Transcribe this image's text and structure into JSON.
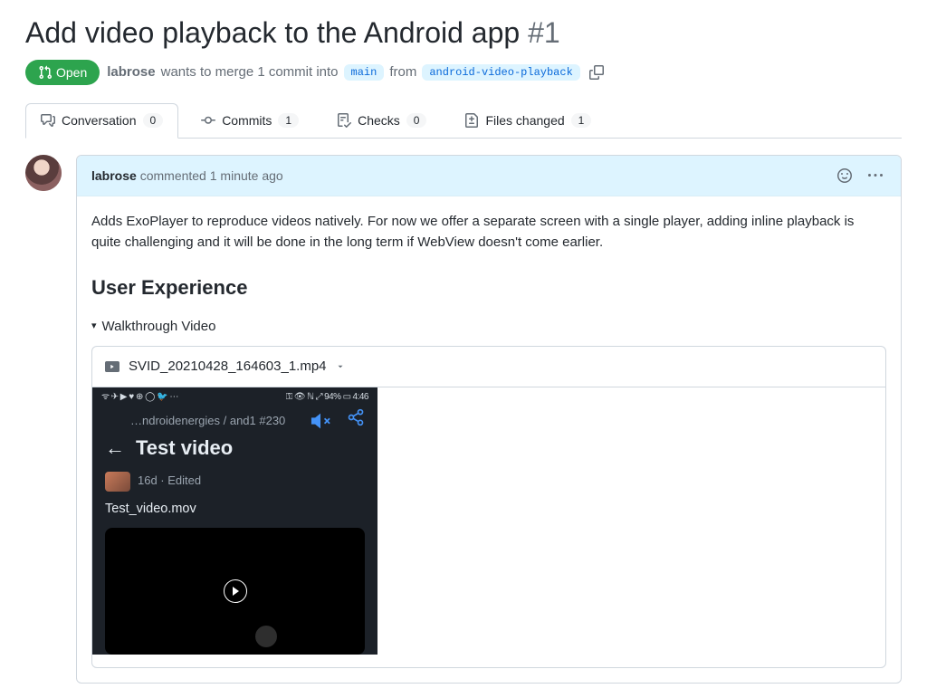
{
  "pr": {
    "title": "Add video playback to the Android app",
    "number": "#1",
    "state": "Open",
    "author": "labrose",
    "merge_text_1": "wants to merge 1 commit into",
    "base_branch": "main",
    "merge_text_2": "from",
    "head_branch": "android-video-playback"
  },
  "tabs": {
    "conversation": {
      "label": "Conversation",
      "count": "0"
    },
    "commits": {
      "label": "Commits",
      "count": "1"
    },
    "checks": {
      "label": "Checks",
      "count": "0"
    },
    "files": {
      "label": "Files changed",
      "count": "1"
    }
  },
  "comment": {
    "author": "labrose",
    "action": "commented",
    "time": "1 minute ago",
    "body": "Adds ExoPlayer to reproduce videos natively. For now we offer a separate screen with a single player, adding inline playback is quite challenging and it will be done in the long term if WebView doesn't come earlier.",
    "section_heading": "User Experience",
    "walkthrough_label": "Walkthrough Video",
    "video_filename": "SVID_20210428_164603_1.mp4"
  },
  "mobile": {
    "status_left": "✈ ▶ ♥ ⊕ ◯ 🐦 ⋯",
    "status_right_pct": "94%",
    "status_time": "4:46",
    "breadcrumb": "…ndroidenergies / and1 #230",
    "title": "Test video",
    "meta": "16d · Edited",
    "filename": "Test_video.mov"
  }
}
